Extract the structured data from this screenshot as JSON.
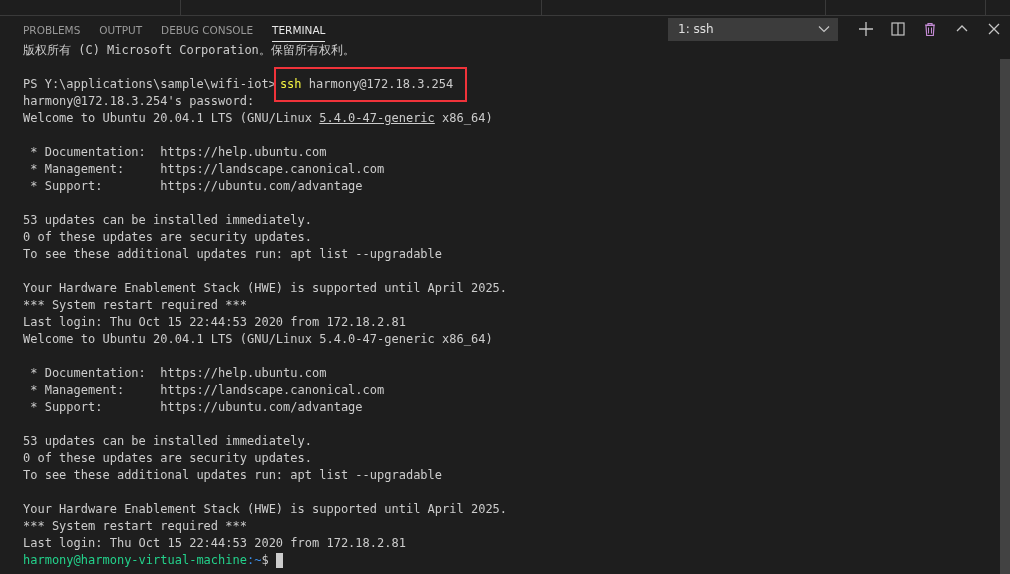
{
  "tabs": [
    {
      "label": "PROBLEMS",
      "selected": false
    },
    {
      "label": "OUTPUT",
      "selected": false
    },
    {
      "label": "DEBUG CONSOLE",
      "selected": false
    },
    {
      "label": "TERMINAL",
      "selected": true
    }
  ],
  "terminal_selector": {
    "value": "1: ssh"
  },
  "terminal_lines": [
    {
      "kind": "text",
      "text": "版权所有 (C) Microsoft Corporation。保留所有权利。"
    },
    {
      "kind": "blank"
    },
    {
      "kind": "command",
      "prompt": "PS Y:\\applications\\sample\\wifi-iot>",
      "program": "ssh",
      "args": "harmony@172.18.3.254",
      "highlighted": true
    },
    {
      "kind": "text",
      "text": "harmony@172.18.3.254's password:"
    },
    {
      "kind": "segments",
      "segments": [
        {
          "text": "Welcome to Ubuntu 20.04.1 LTS (GNU/Linux ",
          "underlined": false
        },
        {
          "text": "5.4.0-47-generic",
          "underlined": true
        },
        {
          "text": " x86_64)",
          "underlined": false
        }
      ]
    },
    {
      "kind": "blank"
    },
    {
      "kind": "text",
      "text": " * Documentation:  https://help.ubuntu.com"
    },
    {
      "kind": "text",
      "text": " * Management:     https://landscape.canonical.com"
    },
    {
      "kind": "text",
      "text": " * Support:        https://ubuntu.com/advantage"
    },
    {
      "kind": "blank"
    },
    {
      "kind": "text",
      "text": "53 updates can be installed immediately."
    },
    {
      "kind": "text",
      "text": "0 of these updates are security updates."
    },
    {
      "kind": "text",
      "text": "To see these additional updates run: apt list --upgradable"
    },
    {
      "kind": "blank"
    },
    {
      "kind": "text",
      "text": "Your Hardware Enablement Stack (HWE) is supported until April 2025."
    },
    {
      "kind": "text",
      "text": "*** System restart required ***"
    },
    {
      "kind": "text",
      "text": "Last login: Thu Oct 15 22:44:53 2020 from 172.18.2.81"
    },
    {
      "kind": "segments",
      "segments": [
        {
          "text": "Welcome to Ubuntu 20.04.1 LTS (GNU/Linux 5.4.0-47-generic x86_64)",
          "underlined": false
        }
      ]
    },
    {
      "kind": "blank"
    },
    {
      "kind": "text",
      "text": " * Documentation:  https://help.ubuntu.com"
    },
    {
      "kind": "text",
      "text": " * Management:     https://landscape.canonical.com"
    },
    {
      "kind": "text",
      "text": " * Support:        https://ubuntu.com/advantage"
    },
    {
      "kind": "blank"
    },
    {
      "kind": "text",
      "text": "53 updates can be installed immediately."
    },
    {
      "kind": "text",
      "text": "0 of these updates are security updates."
    },
    {
      "kind": "text",
      "text": "To see these additional updates run: apt list --upgradable"
    },
    {
      "kind": "blank"
    },
    {
      "kind": "text",
      "text": "Your Hardware Enablement Stack (HWE) is supported until April 2025."
    },
    {
      "kind": "text",
      "text": "*** System restart required ***"
    },
    {
      "kind": "text",
      "text": "Last login: Thu Oct 15 22:44:53 2020 from 172.18.2.81"
    },
    {
      "kind": "shell",
      "user": "harmony@harmony-virtual-machine",
      "path": ":~",
      "symbol": "$",
      "cursor": true
    }
  ]
}
